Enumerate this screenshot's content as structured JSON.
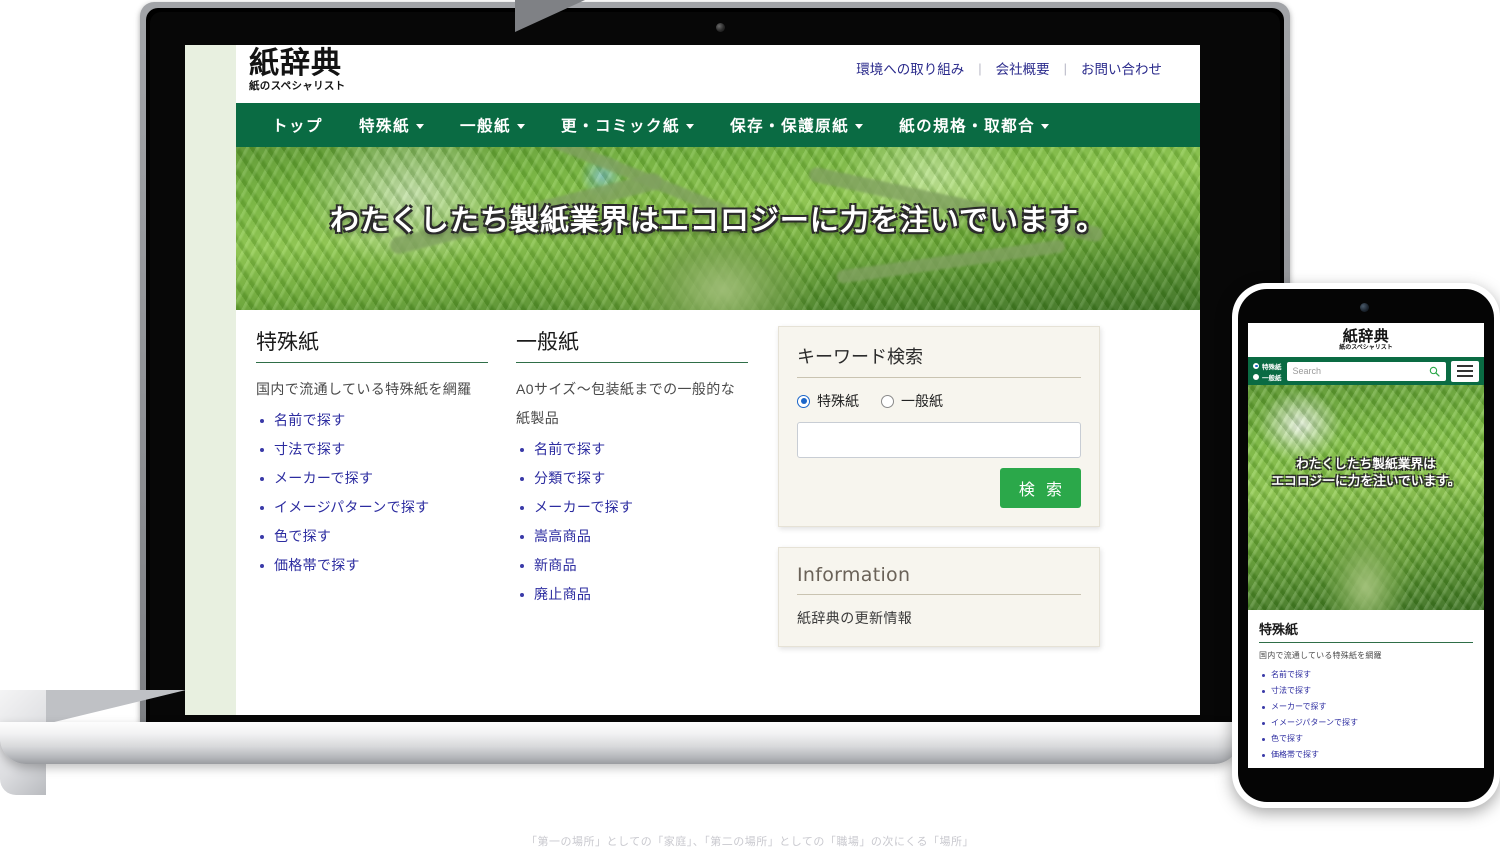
{
  "background_text": "「第一の場所」としての「家庭」、「第二の場所」としての「職場」の次にくる「場所」",
  "site": {
    "logo": {
      "main": "紙辞典",
      "sub": "紙のスペシャリスト"
    },
    "top_links": [
      {
        "label": "環境への取り組み"
      },
      {
        "label": "会社概要"
      },
      {
        "label": "お問い合わせ"
      }
    ],
    "top_link_separator": "|",
    "nav": [
      {
        "label": "トップ",
        "has_dropdown": false
      },
      {
        "label": "特殊紙",
        "has_dropdown": true
      },
      {
        "label": "一般紙",
        "has_dropdown": true
      },
      {
        "label": "更・コミック紙",
        "has_dropdown": true
      },
      {
        "label": "保存・保護原紙",
        "has_dropdown": true
      },
      {
        "label": "紙の規格・取都合",
        "has_dropdown": true
      }
    ],
    "hero": {
      "title": "わたくしたち製紙業界はエコロジーに力を注いでいます。"
    },
    "columns": [
      {
        "title": "特殊紙",
        "description": "国内で流通している特殊紙を網羅",
        "links": [
          "名前で探す",
          "寸法で探す",
          "メーカーで探す",
          "イメージパターンで探す",
          "色で探す",
          "価格帯で探す"
        ]
      },
      {
        "title": "一般紙",
        "description": "A0サイズ〜包装紙までの一般的な紙製品",
        "links": [
          "名前で探す",
          "分類で探す",
          "メーカーで探す",
          "嵩高商品",
          "新商品",
          "廃止商品"
        ]
      }
    ],
    "search_panel": {
      "title": "キーワード検索",
      "radios": [
        {
          "label": "特殊紙",
          "checked": true
        },
        {
          "label": "一般紙",
          "checked": false
        }
      ],
      "input_value": "",
      "input_placeholder": "",
      "button_label": "検 索"
    },
    "information_panel": {
      "title": "Information",
      "body": "紙辞典の更新情報"
    }
  },
  "mobile": {
    "logo": {
      "main": "紙辞典",
      "sub": "紙のスペシャリスト"
    },
    "radios": [
      {
        "label": "特殊紙",
        "checked": true
      },
      {
        "label": "一般紙",
        "checked": false
      }
    ],
    "search_placeholder": "Search",
    "search_value": "",
    "menu_icon": "hamburger-icon",
    "hero": {
      "line1": "わたくしたち製紙業界は",
      "line2": "エコロジーに力を注いでいます。"
    },
    "column": {
      "title": "特殊紙",
      "description": "国内で流通している特殊紙を網羅",
      "links": [
        "名前で探す",
        "寸法で探す",
        "メーカーで探す",
        "イメージパターンで探す",
        "色で探す",
        "価格帯で探す"
      ]
    }
  },
  "colors": {
    "nav_green": "#0a6b43",
    "button_green": "#2ba84a",
    "link_blue": "#2c2ca0",
    "page_bg_green": "#e8f0e0",
    "panel_bg": "#f7f5ee"
  }
}
